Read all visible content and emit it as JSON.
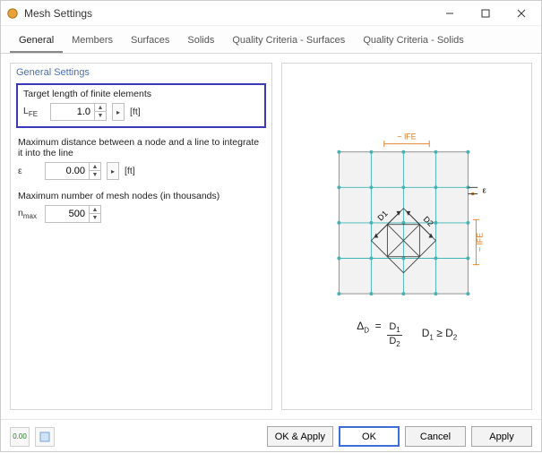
{
  "window": {
    "title": "Mesh Settings"
  },
  "tabs": [
    "General",
    "Members",
    "Surfaces",
    "Solids",
    "Quality Criteria - Surfaces",
    "Quality Criteria - Solids"
  ],
  "active_tab": 0,
  "general": {
    "fieldset_title": "General Settings",
    "target_len": {
      "label": "Target length of finite elements",
      "var": "LFE",
      "value": "1.0",
      "unit": "[ft]"
    },
    "max_dist": {
      "label": "Maximum distance between a node and a line to integrate it into the line",
      "var": "ε",
      "value": "0.00",
      "unit": "[ft]"
    },
    "max_nodes": {
      "label": "Maximum number of mesh nodes (in thousands)",
      "var": "nmax",
      "value": "500"
    }
  },
  "diagram": {
    "label_lfe_top": "~ lFE",
    "label_lfe_right": "~ lFE",
    "label_eps": "ε",
    "d1": "D1",
    "d2": "D2"
  },
  "formula": {
    "delta": "Δ",
    "sub_d": "D",
    "eq": "=",
    "num": "D1",
    "den": "D2",
    "cond": "D1 ≥ D2"
  },
  "footer": {
    "units_badge": "0.00",
    "ok_apply": "OK & Apply",
    "ok": "OK",
    "cancel": "Cancel",
    "apply": "Apply"
  }
}
